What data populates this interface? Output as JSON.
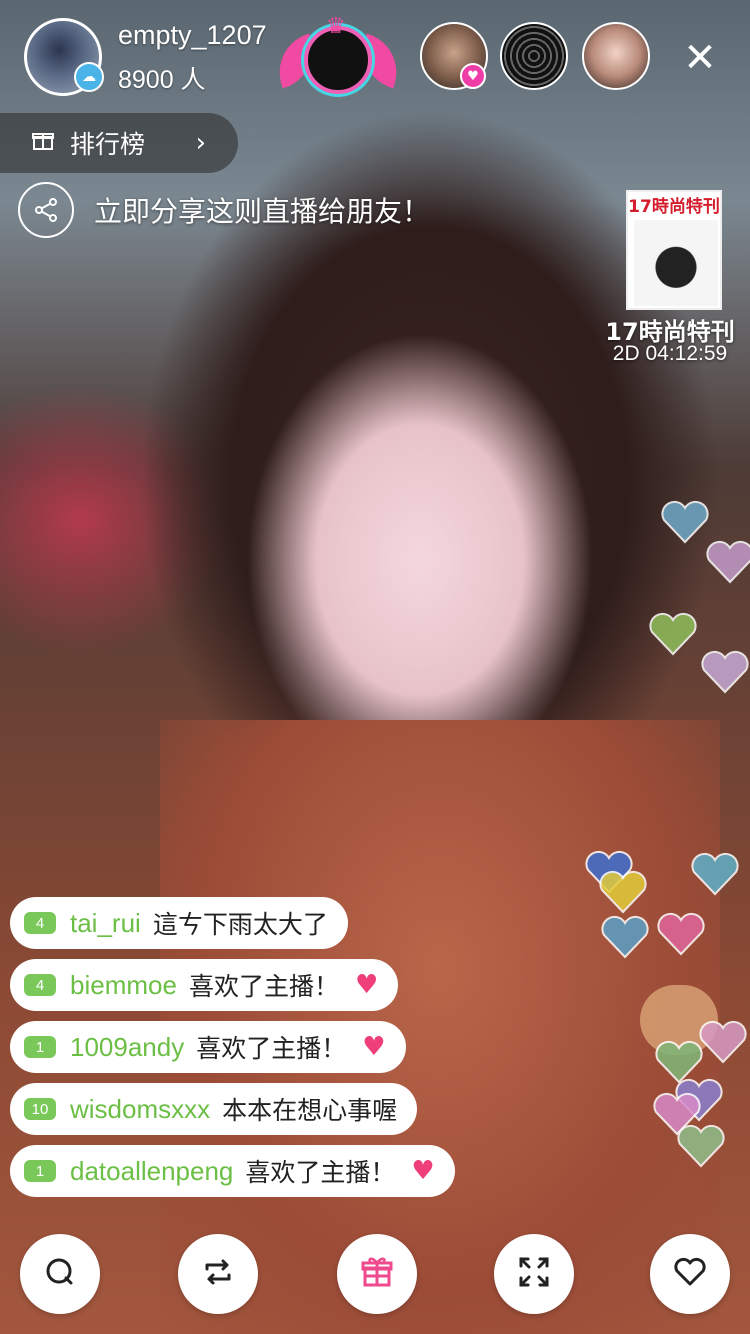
{
  "host": {
    "name": "empty_1207",
    "viewers": "8900 人"
  },
  "ranking": {
    "label": "排行榜",
    "chevron": "›"
  },
  "share": {
    "text": "立即分享这则直播给朋友！"
  },
  "promo": {
    "header": "17時尚特刊",
    "title": "17時尚特刊",
    "timer": "2D 04:12:59"
  },
  "top_viewers": [
    "viewer-1",
    "viewer-2",
    "viewer-3"
  ],
  "comments": [
    {
      "level": "4",
      "user": "tai_rui",
      "text": "這ㄘ下雨太大了",
      "heart": false
    },
    {
      "level": "4",
      "user": "biemmoe",
      "text": "喜欢了主播！",
      "heart": true
    },
    {
      "level": "1",
      "user": "1009andy",
      "text": "喜欢了主播！",
      "heart": true
    },
    {
      "level": "10",
      "user": "wisdomsxxx",
      "text": "本本在想心事喔",
      "heart": false
    },
    {
      "level": "1",
      "user": "datoallenpeng",
      "text": "喜欢了主播！",
      "heart": true
    }
  ],
  "bottom_bar": [
    "comment-icon",
    "share-repost-icon",
    "gift-icon",
    "fullscreen-icon",
    "like-heart-icon"
  ],
  "colors": {
    "level_badge": "#7bc85a",
    "username": "#6cbf45",
    "heart": "#ee3f7a",
    "gift_accent": "#f04a8e"
  }
}
